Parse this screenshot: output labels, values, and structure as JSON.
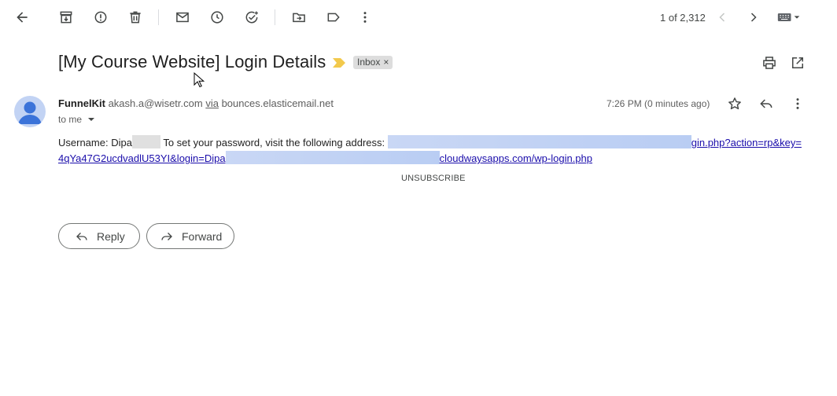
{
  "toolbar": {
    "pager_text": "1 of 2,312"
  },
  "message": {
    "subject": "[My Course Website] Login Details",
    "label": "Inbox",
    "label_remove": "×",
    "sender_name": "FunnelKit",
    "sender_email": "akash.a@wisetr.com",
    "via_text": "via",
    "via_domain": "bounces.elasticemail.net",
    "recipient": "to me",
    "timestamp": "7:26 PM (0 minutes ago)",
    "body": {
      "username_prefix": "Username: Dipa",
      "password_text": " To set your password, visit the following address: ",
      "link_part1": "gin.php?action=rp&key=",
      "link_part2_start": "4qYa47G2ucdvadlU53YI&login=Dipa",
      "link_part2_end": "cloudwaysapps.com/wp-login.php"
    },
    "unsubscribe": "UNSUBSCRIBE"
  },
  "actions": {
    "reply": "Reply",
    "forward": "Forward"
  },
  "colors": {
    "important_marker": "#f2c94c",
    "link": "#1a0dab",
    "avatar_bg": "#c2d3f4",
    "avatar_fg": "#3b73d9"
  }
}
